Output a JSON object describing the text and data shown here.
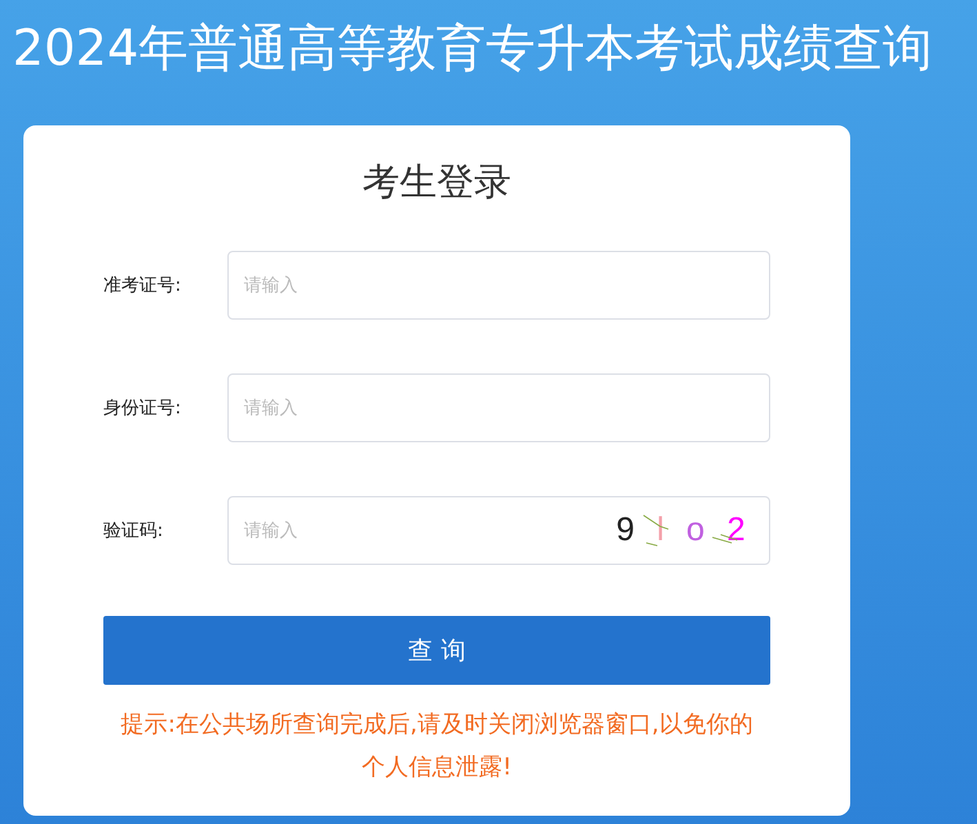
{
  "page_title": "2024年普通高等教育专升本考试成绩查询",
  "login": {
    "title": "考生登录",
    "fields": [
      {
        "kind": "text",
        "label": "准考证号:",
        "placeholder": "请输入"
      },
      {
        "kind": "text",
        "label": "身份证号:",
        "placeholder": "请输入"
      },
      {
        "kind": "captcha",
        "label": "验证码:",
        "placeholder": "请输入",
        "captcha": [
          {
            "char": "9",
            "color": "#222222"
          },
          {
            "char": "l",
            "color": "#f4a0aa"
          },
          {
            "char": "o",
            "color": "#c060e0"
          },
          {
            "char": "2",
            "color": "#ff00ff"
          }
        ]
      }
    ],
    "button": "查 询",
    "notice": "提示:在公共场所查询完成后,请及时关闭浏览器窗口,以免你的个人信息泄露!"
  }
}
